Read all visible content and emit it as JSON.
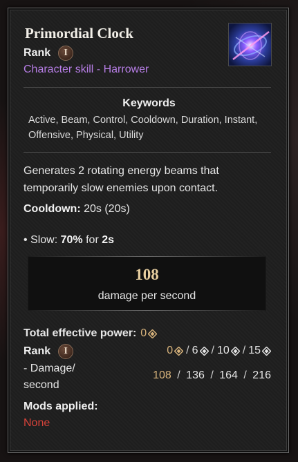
{
  "tooltip": {
    "title": "Primordial Clock",
    "rank_label": "Rank",
    "rank_numeral": "I",
    "skill_type": "Character skill - Harrower",
    "icon_name": "skill-icon-primordial-clock",
    "keywords_title": "Keywords",
    "keywords": "Active, Beam, Control, Cooldown, Duration, Instant, Offensive, Physical, Utility",
    "description": "Generates 2 rotating energy beams that temporarily slow enemies upon contact.",
    "cooldown_label": "Cooldown:",
    "cooldown_value": "20s",
    "cooldown_base": "(20s)",
    "slow_bullet": "• Slow:",
    "slow_value": "70%",
    "slow_for": "for",
    "slow_duration": "2s",
    "damage_value": "108",
    "damage_label": "damage per second",
    "total_power_label": "Total effective power:",
    "total_power_value": "0",
    "rank2_label": "Rank",
    "rank2_numeral": "I",
    "tiers": [
      "0",
      "6",
      "10",
      "15"
    ],
    "tier_separator": "/",
    "damage_row_label_1": "- Damage/",
    "damage_row_label_2": "second",
    "damage_row_values": [
      "108",
      "136",
      "164",
      "216"
    ],
    "mods_title": "Mods applied:",
    "mods_value": "None"
  },
  "colors": {
    "skill_type": "#b77ee6",
    "gold": "#d9b47c",
    "damage_value": "#e8cfa0",
    "mods_none": "#d9433a"
  }
}
